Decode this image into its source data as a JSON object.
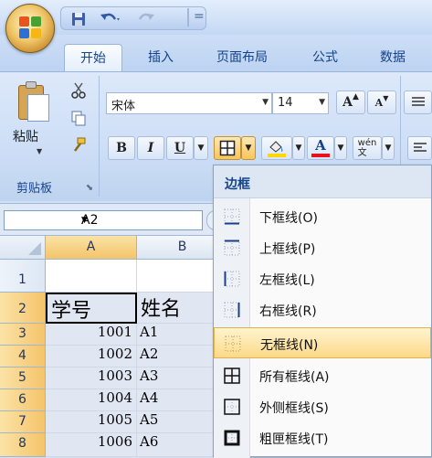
{
  "quick_access": {
    "save_icon": "save-icon",
    "undo_icon": "undo-icon",
    "redo_icon": "redo-icon",
    "more": "="
  },
  "tabs": [
    {
      "label": "开始",
      "active": true
    },
    {
      "label": "插入"
    },
    {
      "label": "页面布局"
    },
    {
      "label": "公式"
    },
    {
      "label": "数据"
    }
  ],
  "clipboard": {
    "paste_label": "粘贴",
    "group_label": "剪贴板"
  },
  "font": {
    "name": "宋体",
    "size": "14",
    "grow": "A",
    "shrink": "A",
    "bold": "B",
    "italic": "I",
    "underline": "U",
    "color_letter": "A",
    "phonetic": "wén\n文"
  },
  "namebox": {
    "value": "A2"
  },
  "columns": [
    "A",
    "B"
  ],
  "rows": [
    {
      "num": "1",
      "a": "",
      "b": ""
    },
    {
      "num": "2",
      "a": "学号",
      "b": "姓名"
    },
    {
      "num": "3",
      "a": "1001",
      "b": "A1"
    },
    {
      "num": "4",
      "a": "1002",
      "b": "A2"
    },
    {
      "num": "5",
      "a": "1003",
      "b": "A3"
    },
    {
      "num": "6",
      "a": "1004",
      "b": "A4"
    },
    {
      "num": "7",
      "a": "1005",
      "b": "A5"
    },
    {
      "num": "8",
      "a": "1006",
      "b": "A6"
    }
  ],
  "border_menu": {
    "title": "边框",
    "items": [
      {
        "label": "下框线(O)",
        "icon": "border-bottom-icon"
      },
      {
        "label": "上框线(P)",
        "icon": "border-top-icon"
      },
      {
        "label": "左框线(L)",
        "icon": "border-left-icon"
      },
      {
        "label": "右框线(R)",
        "icon": "border-right-icon"
      },
      {
        "label": "无框线(N)",
        "icon": "no-border-icon",
        "highlighted": true
      },
      {
        "label": "所有框线(A)",
        "icon": "all-borders-icon"
      },
      {
        "label": "外侧框线(S)",
        "icon": "outside-borders-icon"
      },
      {
        "label": "粗匣框线(T)",
        "icon": "thick-box-border-icon"
      }
    ]
  },
  "colors": {
    "accent": "#15428b",
    "highlight": "#fcd988",
    "font_color": "#e8141b",
    "fill_color": "#ffd800"
  }
}
